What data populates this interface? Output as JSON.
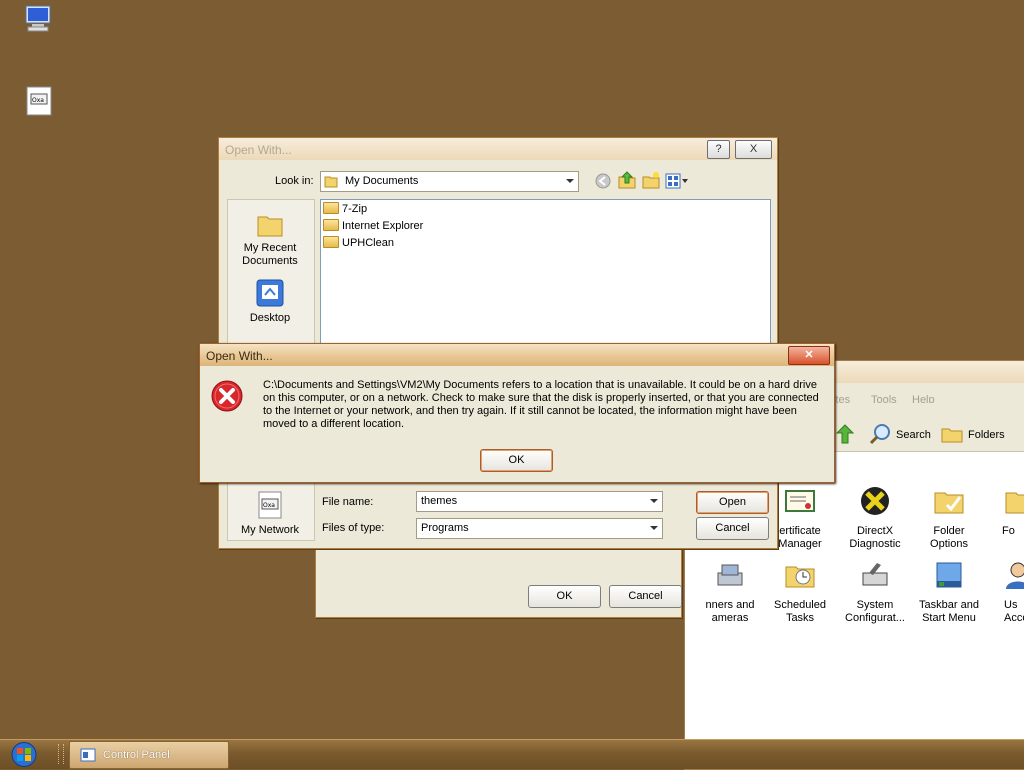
{
  "desktop": {
    "icons": [
      {
        "name": "my-computer-icon"
      },
      {
        "name": "program-file-icon"
      }
    ]
  },
  "control_panel": {
    "menu": {
      "tools": "Tools",
      "help": "Help",
      "ites": "ites"
    },
    "toolbar": {
      "search": "Search",
      "folders": "Folders"
    },
    "items_row1": [
      {
        "label": "ertificate\nManager"
      },
      {
        "label": "DirectX\nDiagnostic"
      },
      {
        "label": "Folder\nOptions"
      },
      {
        "label": "Fo"
      }
    ],
    "items_row2": [
      {
        "label": "nners and\nameras"
      },
      {
        "label": "Scheduled\nTasks"
      },
      {
        "label": "System\nConfigurat..."
      },
      {
        "label": "Taskbar and\nStart Menu"
      },
      {
        "label": "Us\nAcco"
      }
    ]
  },
  "back_dialog": {
    "ok": "OK",
    "cancel": "Cancel"
  },
  "open_with_dialog": {
    "title": "Open With...",
    "help_btn": "?",
    "close_btn": "X",
    "look_in_label": "Look in:",
    "look_in_value": "My Documents",
    "places": {
      "recent": "My Recent\nDocuments",
      "desktop": "Desktop",
      "network": "My Network"
    },
    "files": [
      {
        "name": "7-Zip"
      },
      {
        "name": "Internet Explorer"
      },
      {
        "name": "UPHClean"
      }
    ],
    "file_name_label": "File name:",
    "file_name_value": "themes",
    "file_type_label": "Files of type:",
    "file_type_value": "Programs",
    "open_btn": "Open",
    "cancel_btn": "Cancel"
  },
  "error_dialog": {
    "title": "Open With...",
    "message": "C:\\Documents and Settings\\VM2\\My Documents refers to a location that is unavailable. It could be on a hard drive on this computer, or on a network. Check to make sure that the disk is properly inserted, or that you are connected to the Internet or your network, and then try again. If it still cannot be located, the information might have been moved to a different location.",
    "ok_btn": "OK",
    "icon": "error-icon"
  },
  "taskbar": {
    "task_label": "Control Panel"
  }
}
